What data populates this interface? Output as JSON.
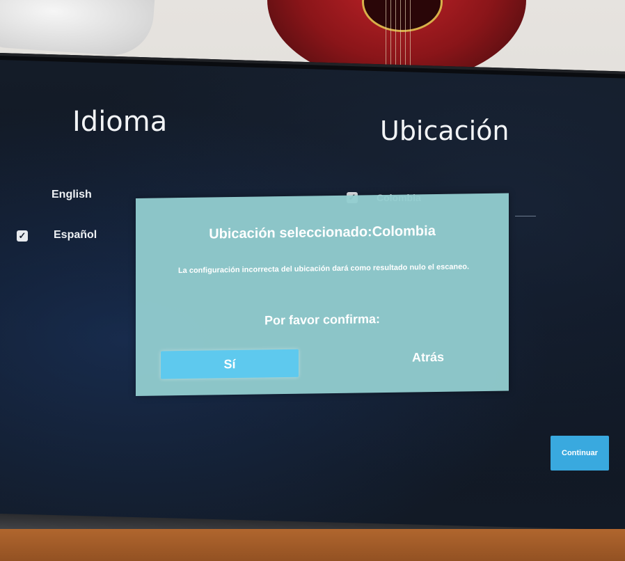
{
  "language": {
    "title": "Idioma",
    "options": [
      {
        "label": "English",
        "checked": false
      },
      {
        "label": "Español",
        "checked": true
      }
    ]
  },
  "location": {
    "title": "Ubicación",
    "selected": "Colombia"
  },
  "dialog": {
    "title": "Ubicación seleccionado:Colombia",
    "message": "La configuración incorrecta del ubicación dará como resultado nulo el escaneo.",
    "confirm_prompt": "Por favor confirma:",
    "yes_label": "Sí",
    "back_label": "Atrás"
  },
  "footer": {
    "continue_label": "Continuar"
  },
  "colors": {
    "dialog_bg": "#92ccce",
    "primary_button": "#5ec9ee",
    "continue_button": "#39a9df"
  },
  "icons": {
    "check": "check-icon"
  }
}
